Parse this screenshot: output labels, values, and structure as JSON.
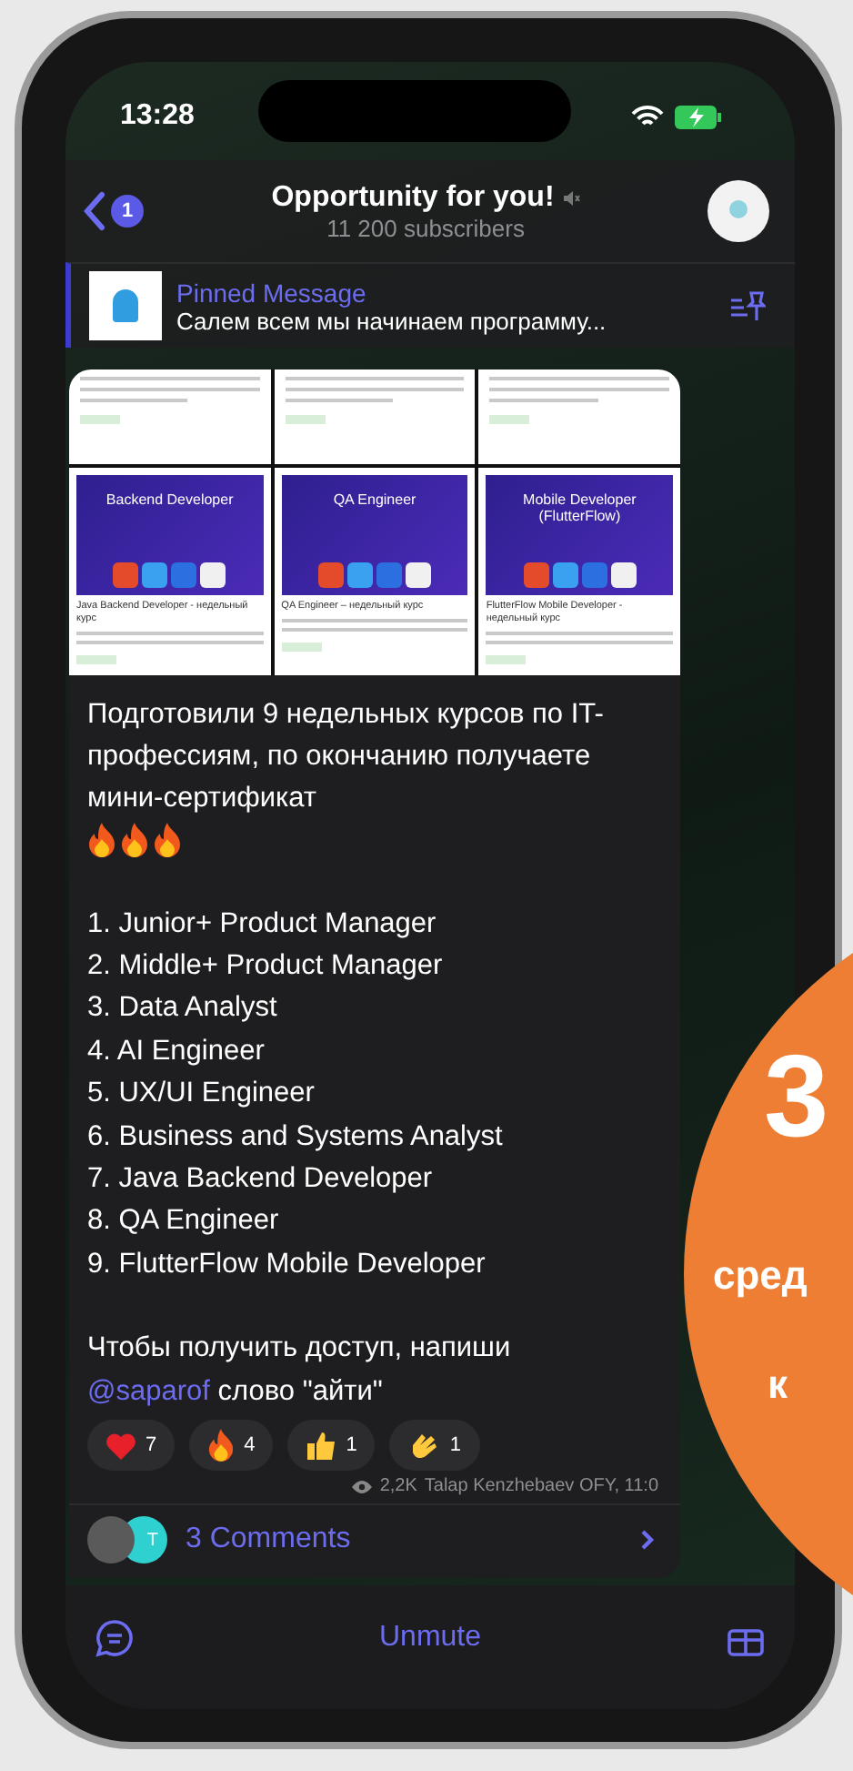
{
  "status_bar": {
    "time": "13:28"
  },
  "header": {
    "unread_count": "1",
    "title": "Opportunity for you!",
    "subtitle": "11 200 subscribers"
  },
  "pinned": {
    "label": "Pinned Message",
    "text": "Салем всем мы начинаем программу..."
  },
  "post": {
    "course_cards": [
      {
        "banner": "Backend Developer",
        "caption": "Java Backend Developer - недельный курс"
      },
      {
        "banner": "QA Engineer",
        "caption": "QA Engineer – недельный курс"
      },
      {
        "banner": "Mobile Developer (FlutterFlow)",
        "caption": "FlutterFlow Mobile Developer - недельный курс"
      }
    ],
    "intro": "Подготовили 9 недельных курсов по IT-профессиям, по окончанию получаете мини-сертификат",
    "courses": [
      "1. Junior+ Product Manager",
      "2. Middle+ Product Manager",
      "3. Data Analyst",
      "4. AI Engineer",
      "5. UX/UI Engineer",
      "6. Business and Systems Analyst",
      "7. Java Backend Developer",
      "8. QA Engineer",
      "9. FlutterFlow Mobile Developer"
    ],
    "cta": "Чтобы получить доступ, напиши",
    "mention": "@saparof",
    "cta_end": "слово \"айти\"",
    "reactions": [
      {
        "kind": "heart",
        "count": "7"
      },
      {
        "kind": "fire",
        "count": "4"
      },
      {
        "kind": "thumbs",
        "count": "1"
      },
      {
        "kind": "clap",
        "count": "1"
      }
    ],
    "views": "2,2K",
    "author": "Talap Kenzhebaev OFY, 11:0"
  },
  "comments": {
    "avatar_initial": "T",
    "label": "3 Comments"
  },
  "bottom_bar": {
    "action": "Unmute"
  },
  "overlay": {
    "number": "3",
    "line_1": "сред",
    "line_2": "к"
  }
}
